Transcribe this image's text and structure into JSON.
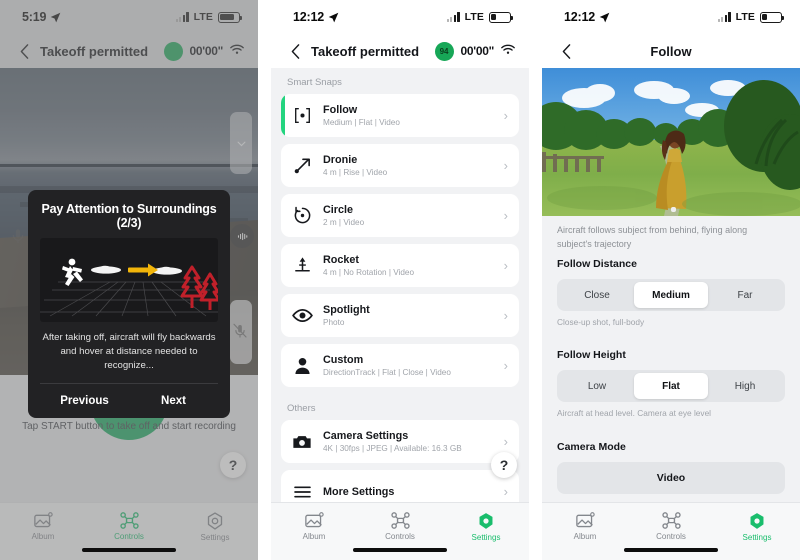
{
  "panel1": {
    "status": {
      "time": "5:19",
      "carrier": "LTE",
      "battery_level": 78
    },
    "nav": {
      "title": "Takeoff permitted",
      "timer": "00'00\"",
      "drone_battery": ""
    },
    "tip": {
      "title": "Pay Attention to Surroundings (2/3)",
      "description": "After taking off, aircraft will fly backwards and hover at distance needed to recognize...",
      "previous_label": "Previous",
      "next_label": "Next"
    },
    "hint": "Tap START button to take off and start recording",
    "help_label": "?",
    "tabs": [
      {
        "label": "Album",
        "icon": "album-icon",
        "active": false
      },
      {
        "label": "Controls",
        "icon": "drone-icon",
        "active": true
      },
      {
        "label": "Settings",
        "icon": "gear-icon",
        "active": false
      }
    ]
  },
  "panel2": {
    "status": {
      "time": "12:12",
      "carrier": "LTE",
      "battery_level": 30
    },
    "nav": {
      "title": "Takeoff permitted",
      "timer": "00'00\"",
      "drone_battery": "94"
    },
    "sections": [
      {
        "label": "Smart Snaps",
        "items": [
          {
            "name": "Follow",
            "sub": "Medium | Flat | Video",
            "icon": "follow-target-icon",
            "selected": true
          },
          {
            "name": "Dronie",
            "sub": "4 m | Rise | Video",
            "icon": "dronie-arrow-icon",
            "selected": false
          },
          {
            "name": "Circle",
            "sub": "2 m | Video",
            "icon": "circle-orbit-icon",
            "selected": false
          },
          {
            "name": "Rocket",
            "sub": "4 m | No Rotation | Video",
            "icon": "rocket-up-icon",
            "selected": false
          },
          {
            "name": "Spotlight",
            "sub": "Photo",
            "icon": "eye-icon",
            "selected": false
          },
          {
            "name": "Custom",
            "sub": "DirectionTrack | Flat | Close | Video",
            "icon": "person-icon",
            "selected": false
          }
        ]
      },
      {
        "label": "Others",
        "items": [
          {
            "name": "Camera Settings",
            "sub": "4K | 30fps | JPEG | Available: 16.3 GB",
            "icon": "camera-icon",
            "selected": false
          },
          {
            "name": "More Settings",
            "sub": "",
            "icon": "hamburger-icon",
            "selected": false
          }
        ]
      }
    ],
    "help_label": "?",
    "tabs": [
      {
        "label": "Album",
        "icon": "album-icon",
        "active": false
      },
      {
        "label": "Controls",
        "icon": "drone-icon",
        "active": false
      },
      {
        "label": "Settings",
        "icon": "gear-icon",
        "active": true
      }
    ]
  },
  "panel3": {
    "status": {
      "time": "12:12",
      "carrier": "LTE",
      "battery_level": 30
    },
    "nav": {
      "title": "Follow"
    },
    "description": "Aircraft follows subject from behind, flying along subject's trajectory",
    "groups": [
      {
        "title": "Follow Distance",
        "options": [
          "Close",
          "Medium",
          "Far"
        ],
        "selected": "Medium",
        "note": "Close-up shot, full-body"
      },
      {
        "title": "Follow Height",
        "options": [
          "Low",
          "Flat",
          "High"
        ],
        "selected": "Flat",
        "note": "Aircraft at head level. Camera at eye level"
      }
    ],
    "camera_mode": {
      "title": "Camera Mode",
      "value": "Video"
    },
    "tabs": [
      {
        "label": "Album",
        "icon": "album-icon",
        "active": false
      },
      {
        "label": "Controls",
        "icon": "drone-icon",
        "active": false
      },
      {
        "label": "Settings",
        "icon": "gear-icon",
        "active": true
      }
    ]
  },
  "colors": {
    "accent": "#19bd6c",
    "start_button": "#14a85c",
    "selected_bar": "#23d47f",
    "tip_bg": "#222224"
  }
}
